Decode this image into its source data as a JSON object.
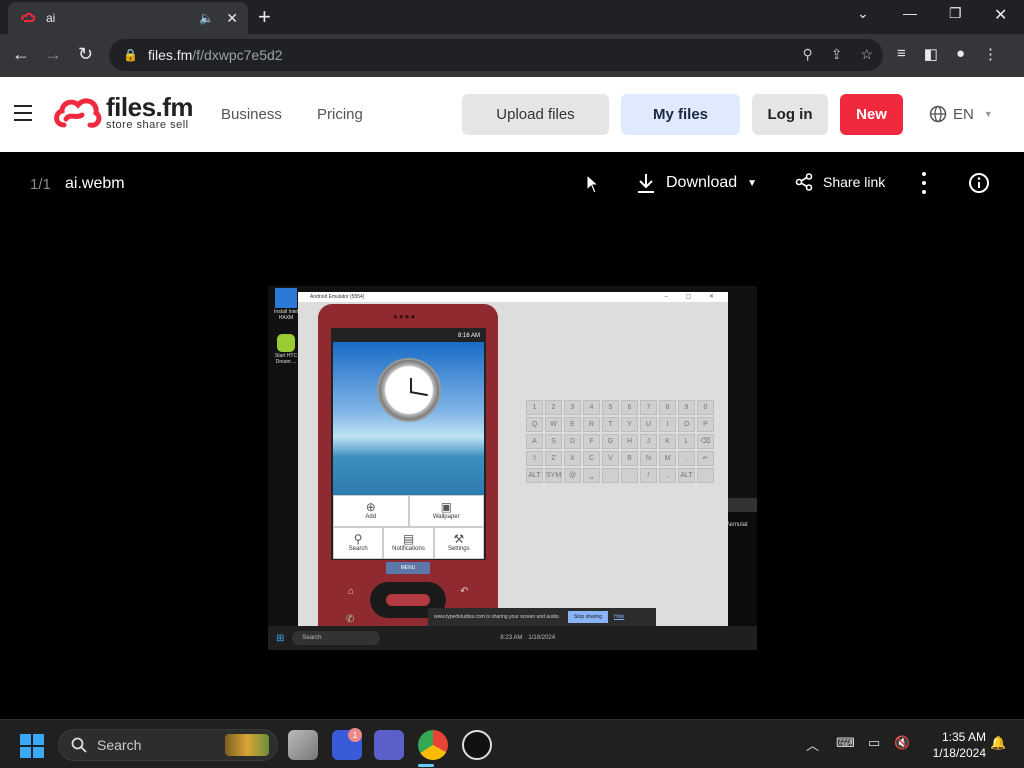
{
  "browser": {
    "tab_title": "ai",
    "url_host": "files.fm",
    "url_path": "/f/dxwpc7e5d2"
  },
  "site": {
    "logo_name": "files.fm",
    "logo_tagline": "store share sell",
    "nav": [
      "Business",
      "Pricing"
    ],
    "upload_label": "Upload files",
    "myfiles_label": "My files",
    "login_label": "Log in",
    "new_label": "New",
    "language": "EN"
  },
  "viewer": {
    "counter": "1/1",
    "file_name": "ai.webm",
    "download_label": "Download",
    "share_label": "Share link"
  },
  "video": {
    "window_title": "Android Emulator (5554)",
    "desktop_icons": [
      "Install Intel HAXM",
      "Start HTC Dream ..."
    ],
    "status_time": "8:16 AM",
    "menu_top": [
      "Add",
      "Wallpaper"
    ],
    "menu_bottom": [
      "Search",
      "Notifications",
      "Settings"
    ],
    "menu_button": "MENU",
    "keys": [
      "1",
      "2",
      "3",
      "4",
      "5",
      "6",
      "7",
      "8",
      "9",
      "0",
      "Q",
      "W",
      "E",
      "R",
      "T",
      "Y",
      "U",
      "I",
      "O",
      "P",
      "A",
      "S",
      "D",
      "F",
      "G",
      "H",
      "J",
      "K",
      "L",
      "⌫",
      "⇧",
      "Z",
      "X",
      "C",
      "V",
      "B",
      "N",
      "M",
      ".",
      "↵",
      "ALT",
      "SYM",
      "@",
      "␣",
      "",
      "",
      "/",
      ",",
      "ALT",
      ""
    ],
    "share_notice": "www.typedstudios.com is sharing your screen and audio.",
    "stop_sharing": "Stop sharing",
    "hide": "Hide",
    "cmd_text": "\\emulat",
    "inner_search": "Search",
    "inner_time": "8:23 AM",
    "inner_date": "1/18/2024"
  },
  "taskbar": {
    "search_label": "Search",
    "badge_count": "1",
    "time": "1:35 AM",
    "date": "1/18/2024"
  },
  "colors": {
    "accent_red": "#f0293e",
    "myfiles_bg": "#dfeafe",
    "windows_blue": "#3ba9f5"
  }
}
